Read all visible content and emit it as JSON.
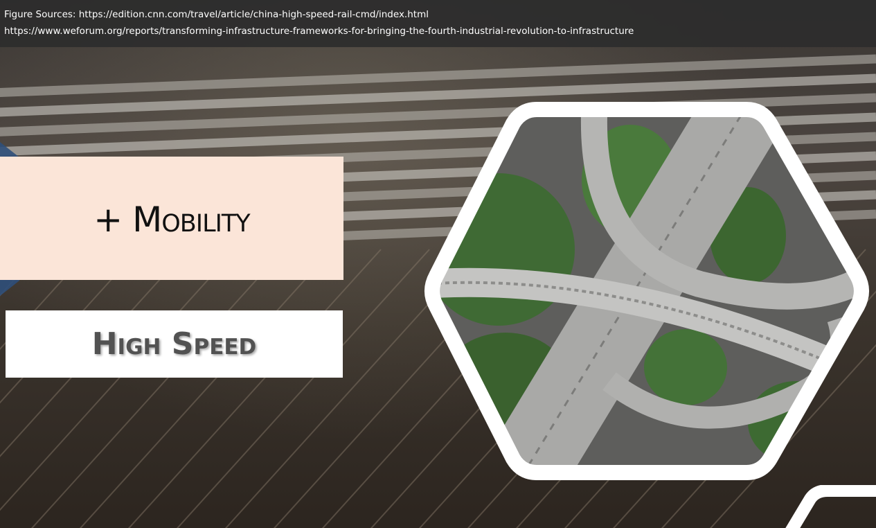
{
  "sources": {
    "line1": "Figure Sources: https://edition.cnn.com/travel/article/china-high-speed-rail-cmd/index.html",
    "line2": "https://www.weforum.org/reports/transforming-infrastructure-frameworks-for-bringing-the-fourth-industrial-revolution-to-infrastructure"
  },
  "titles": {
    "mobility": "+ Mobility",
    "speed": "High Speed"
  },
  "images": {
    "background": "high-speed-trains-rail-yard-photo",
    "hexagon": "highway-interchange-aerial-photo"
  },
  "colors": {
    "mobility_box": "#fbe5d8",
    "speed_box": "#ffffff",
    "speed_text": "#525252",
    "caption_bar": "#2d2d2d",
    "accent_blue": "#2f4f7a"
  }
}
